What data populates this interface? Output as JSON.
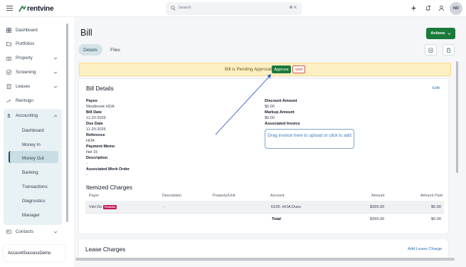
{
  "topbar": {
    "brand": "rentvine",
    "search_placeholder": "Search",
    "search_shortcut": "⌘ K",
    "avatar_initials": "ND"
  },
  "sidebar": {
    "items": [
      {
        "label": "Dashboard",
        "icon": "dashboard-icon"
      },
      {
        "label": "Portfolios",
        "icon": "folder-icon"
      },
      {
        "label": "Property",
        "icon": "building-icon"
      },
      {
        "label": "Screening",
        "icon": "screening-icon"
      },
      {
        "label": "Leases",
        "icon": "lease-icon"
      },
      {
        "label": "Rentsign",
        "icon": "signature-icon"
      },
      {
        "label": "Accounting",
        "icon": "dollar-icon"
      },
      {
        "label": "Contacts",
        "icon": "contacts-icon"
      }
    ],
    "accounting_sub": [
      "Dashboard",
      "Money In",
      "Money Out",
      "Banking",
      "Transactions",
      "Diagnostics",
      "Manager"
    ],
    "account_name": "AccountSuccessDemo"
  },
  "page": {
    "title": "Bill",
    "actions_label": "Actions",
    "tabs": [
      "Details",
      "Files"
    ]
  },
  "banner": {
    "text": "Bill is Pending Approval",
    "approve_label": "Approve",
    "void_label": "Void"
  },
  "bill_details": {
    "title": "Bill Details",
    "edit_label": "Edit",
    "left_fields": [
      {
        "label": "Payee",
        "value": "Westbrook HOA"
      },
      {
        "label": "Bill Date",
        "value": "11-20-2025"
      },
      {
        "label": "Due Date",
        "value": "11-20-2025"
      },
      {
        "label": "Reference",
        "value": "HOA"
      },
      {
        "label": "Payment Memo",
        "value": "Net 15"
      },
      {
        "label": "Description",
        "value": "-"
      },
      {
        "label": "Associated Work Order",
        "value": "-"
      }
    ],
    "right_fields": [
      {
        "label": "Discount Amount",
        "value": "$0.00"
      },
      {
        "label": "Markup Amount",
        "value": "$0.00"
      },
      {
        "label": "Associated Invoice",
        "value": ""
      }
    ],
    "dropzone_text": "Drag invoice here to upload or click to add"
  },
  "itemized": {
    "title": "Itemized Charges",
    "columns": [
      "Payer",
      "Description",
      "Property/Unit",
      "Account",
      "Amount",
      "Amount Paid"
    ],
    "rows": [
      {
        "payer": "Viet Do",
        "badge": "Portfolio",
        "description": "-",
        "property_unit": "",
        "account": "6105: HOA Dues",
        "amount": "$355.00",
        "amount_paid": "$0.00"
      }
    ],
    "total_label": "Total",
    "total_amount": "$355.00",
    "total_paid": "$0.00"
  },
  "lease_charges": {
    "title": "Lease Charges",
    "add_label": "Add Lease Charge"
  },
  "colors": {
    "primary_green": "#1b7a3a",
    "banner_yellow": "#fdf0c2",
    "link_blue": "#2c6fb3",
    "portfolio_badge": "#c2185b",
    "annotation_arrow": "#2f57c9"
  }
}
